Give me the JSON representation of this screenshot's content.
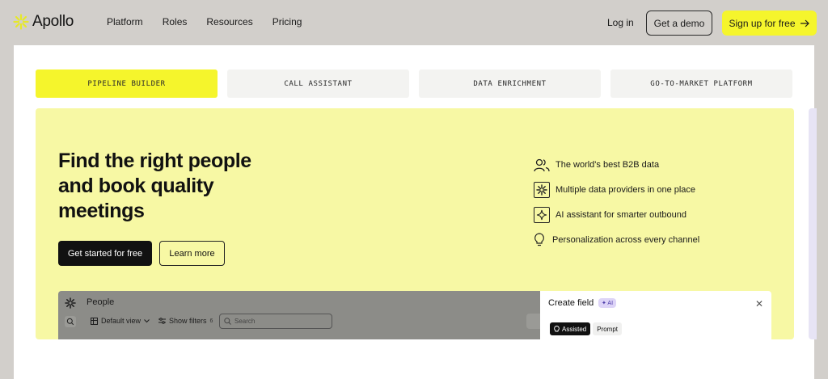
{
  "nav": {
    "brand": "Apollo",
    "links": [
      "Platform",
      "Roles",
      "Resources",
      "Pricing"
    ],
    "login": "Log in",
    "demo": "Get a demo",
    "signup": "Sign up for free"
  },
  "tabs": [
    "PIPELINE BUILDER",
    "CALL ASSISTANT",
    "DATA ENRICHMENT",
    "GO-TO-MARKET PLATFORM"
  ],
  "hero": {
    "headline": "Find the right people and book quality meetings",
    "primary_cta": "Get started for free",
    "secondary_cta": "Learn more",
    "features": [
      {
        "icon": "people-icon",
        "text": "The world's best B2B data"
      },
      {
        "icon": "asterisk-icon",
        "text": "Multiple data providers in one place"
      },
      {
        "icon": "sparkle-icon",
        "text": "AI assistant for smarter outbound"
      },
      {
        "icon": "lightbulb-icon",
        "text": "Personalization across every channel"
      }
    ]
  },
  "preview": {
    "title": "People",
    "view": "Default view",
    "filters": "Show filters",
    "filters_count": "6",
    "search_placeholder": "Search",
    "panel_title": "Create field",
    "ai_badge": "✦ AI",
    "seg_on": "Assisted",
    "seg_off": "Prompt"
  },
  "colors": {
    "accent": "#f5f52c",
    "hero_bg": "#f7f8a4",
    "page_bg": "#d2cfcb"
  }
}
